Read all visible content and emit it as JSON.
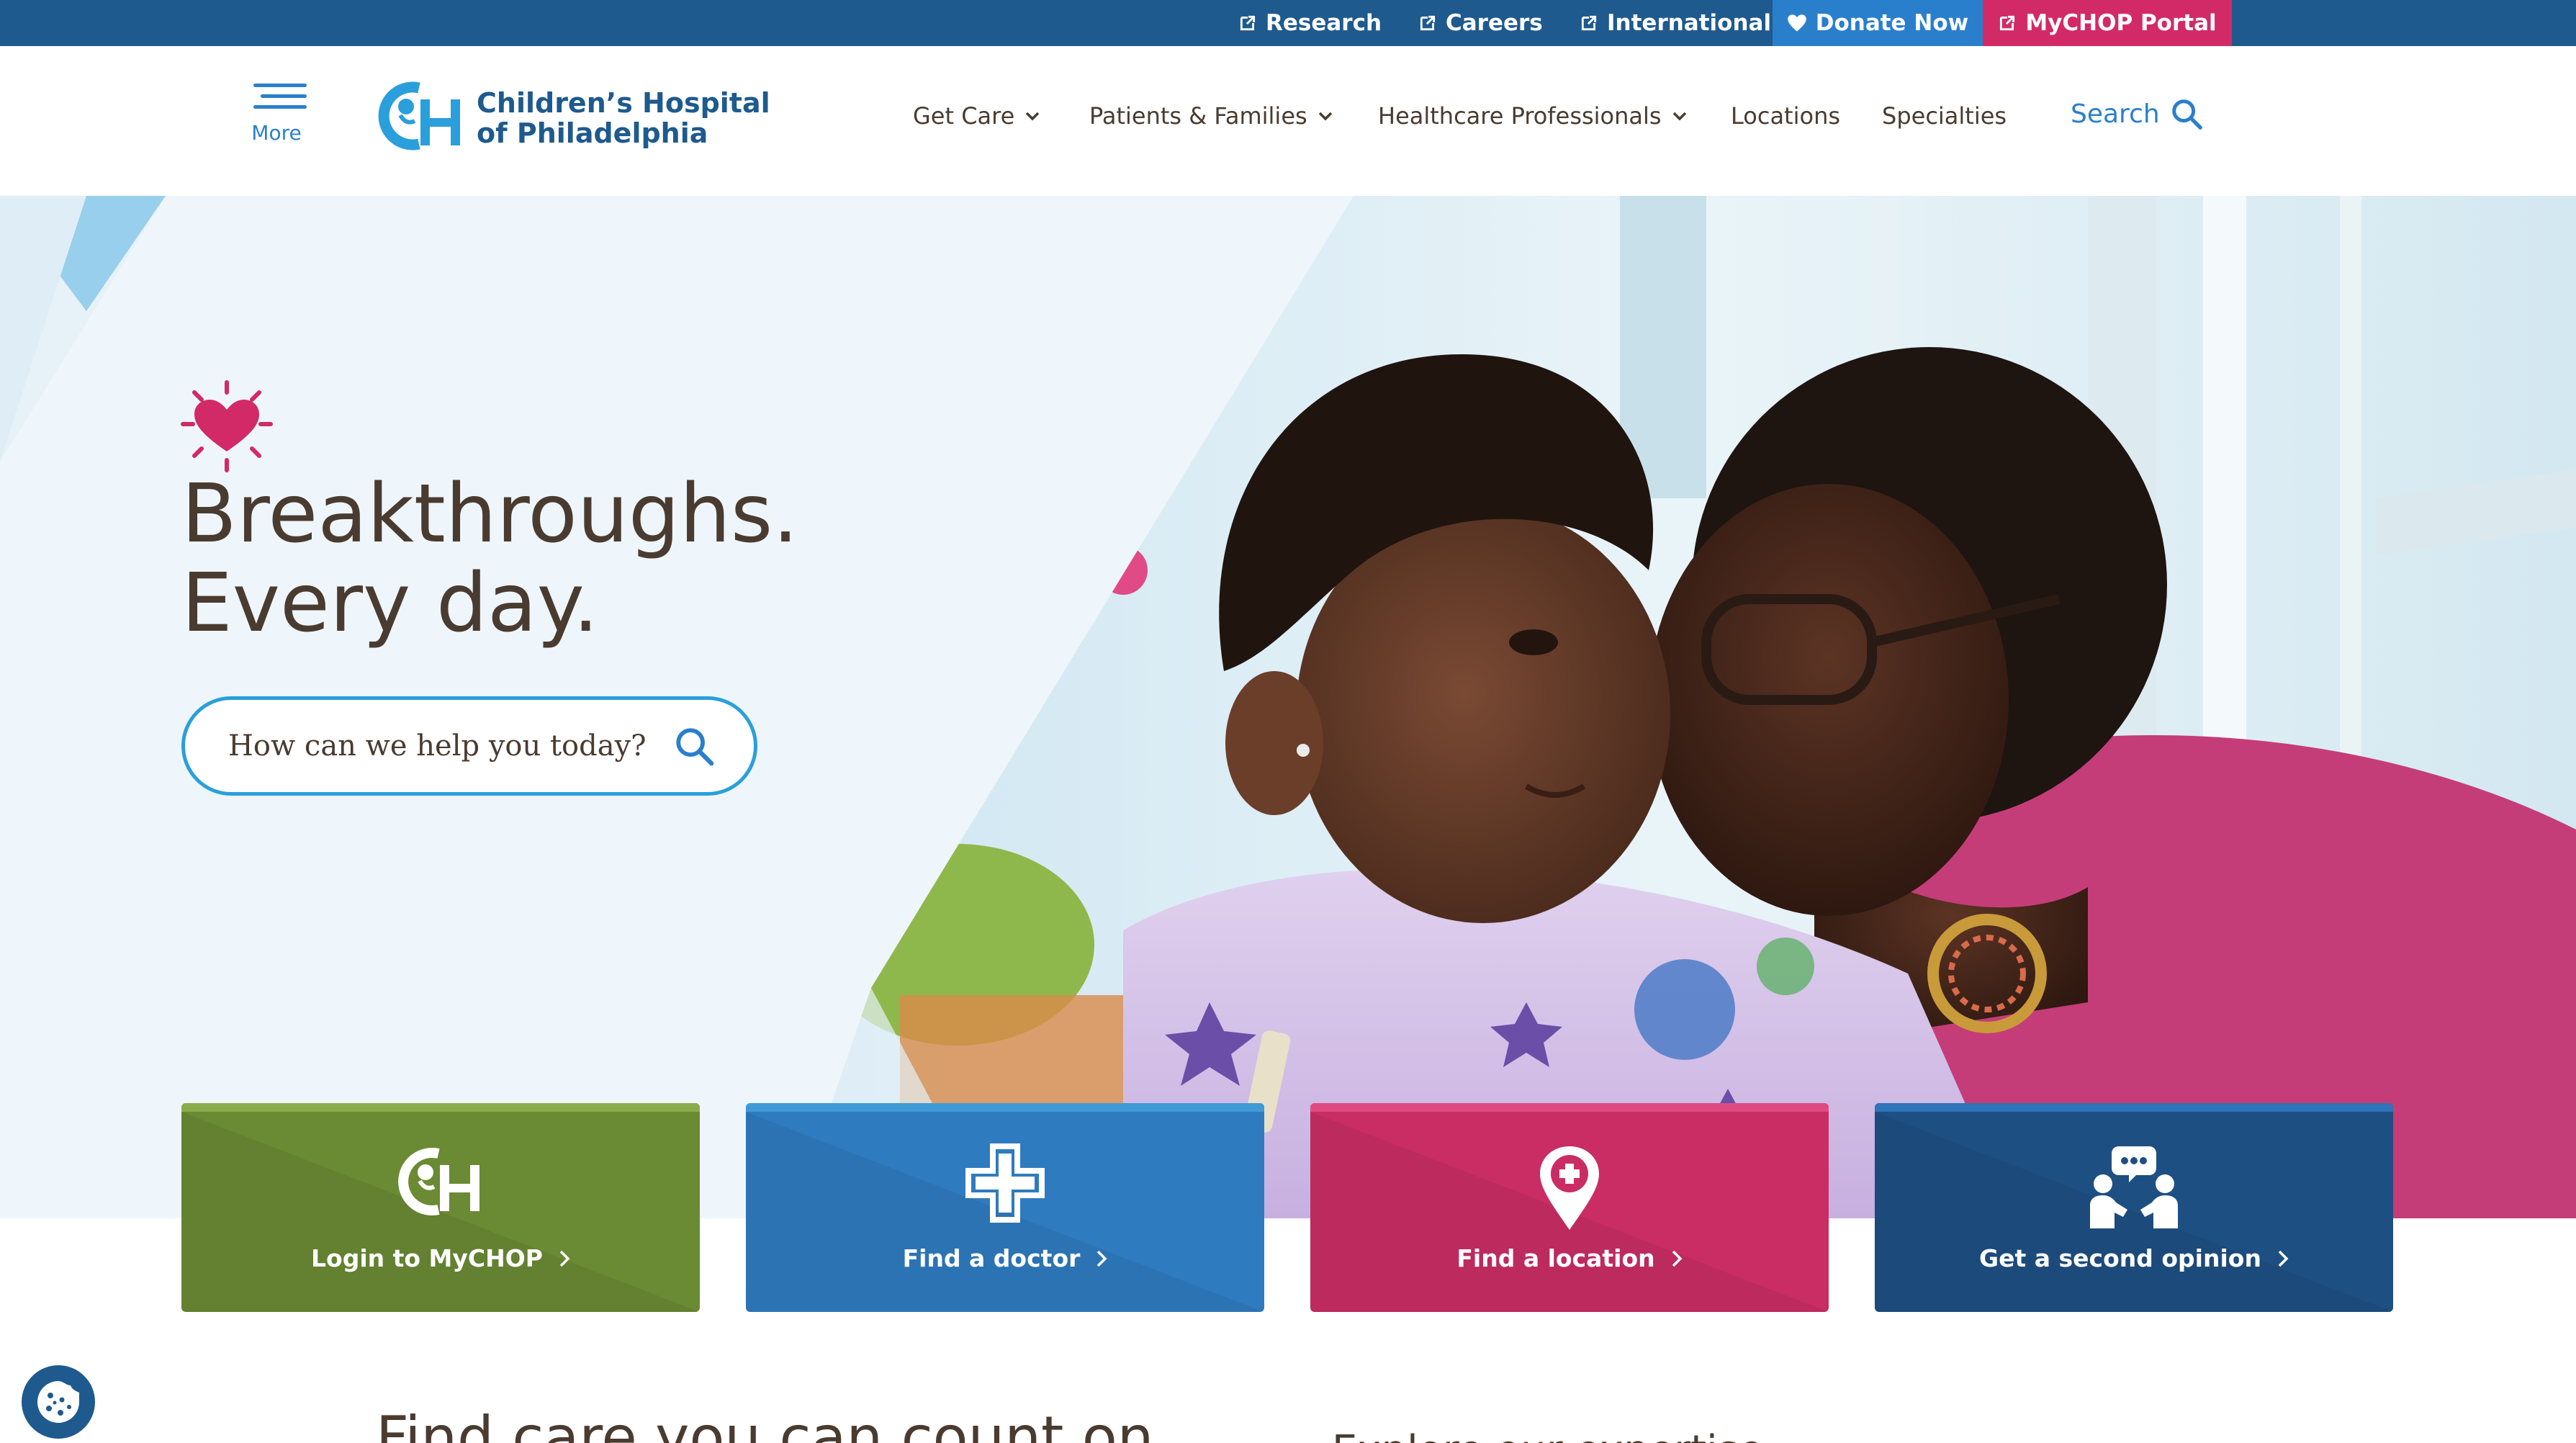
{
  "utility_bar": {
    "research": "Research",
    "careers": "Careers",
    "international": "International",
    "donate": "Donate Now",
    "mychop_portal": "MyCHOP Portal"
  },
  "header": {
    "more_label": "More",
    "logo_line1": "Children’s Hospital",
    "logo_line2": "of Philadelphia",
    "logo_mark": "CH",
    "nav": {
      "get_care": "Get Care",
      "patients_families": "Patients & Families",
      "healthcare_professionals": "Healthcare Professionals",
      "locations": "Locations",
      "specialties": "Specialties"
    },
    "search_label": "Search"
  },
  "hero": {
    "headline_line1": "Breakthroughs.",
    "headline_line2": "Every day.",
    "search_placeholder": "How can we help you today?"
  },
  "tiles": {
    "login": "Login to MyCHOP",
    "doctor": "Find a doctor",
    "location": "Find a location",
    "second_opinion": "Get a second opinion"
  },
  "below": {
    "title": "Find care you can count on",
    "title_2": "Explore our expertise"
  },
  "colors": {
    "utility_bar": "#1e5a8e",
    "donate": "#2a7fcd",
    "mychop": "#d22a66",
    "tile_green": "#6a8a33",
    "tile_blue": "#2f7bbf",
    "tile_pink": "#c92d63",
    "tile_navy": "#1e4f82",
    "accent_blue": "#2a9fdc"
  }
}
